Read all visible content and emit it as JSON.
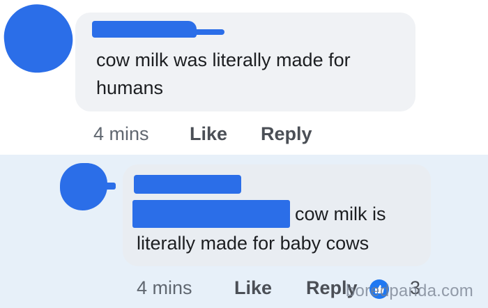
{
  "comments": [
    {
      "text": "cow milk was literally made for humans",
      "time": "4 mins",
      "like_label": "Like",
      "reply_label": "Reply"
    },
    {
      "text_line1": "cow milk is",
      "text_line2": "literally made for baby cows",
      "time": "4 mins",
      "like_label": "Like",
      "reply_label": "Reply",
      "reaction_count": "3",
      "reaction_icon": "like-thumb-icon"
    }
  ],
  "watermark": "boredpanda.com",
  "colors": {
    "redaction": "#2b6ee8",
    "bubble": "#f0f2f5",
    "reply_background": "#e7f0f9",
    "reaction": "#1f78f2"
  }
}
